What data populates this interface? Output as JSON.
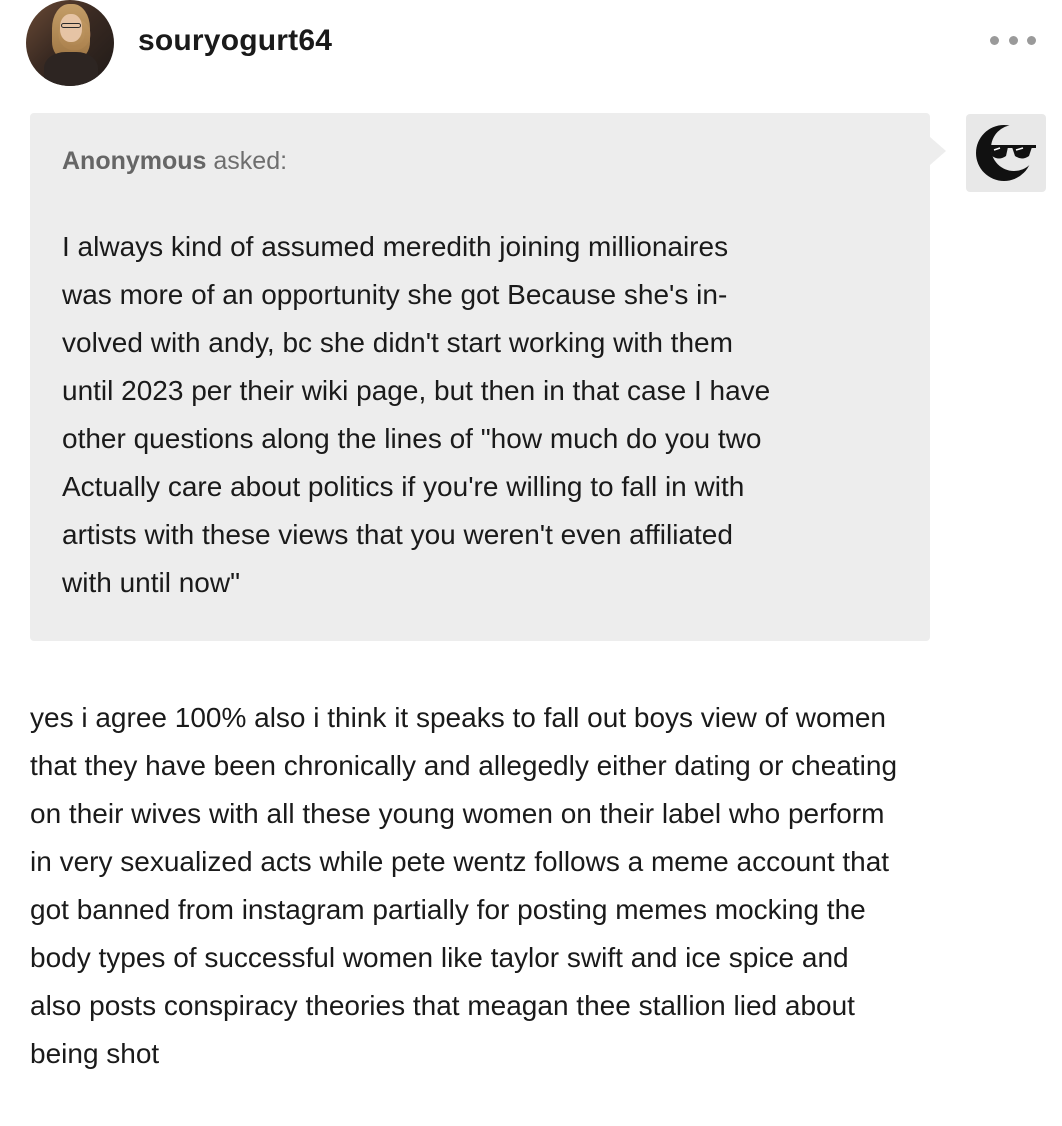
{
  "post": {
    "author": {
      "username": "souryogurt64",
      "avatar_icon": "user-avatar-photo"
    },
    "menu_icon": "more-options-ellipsis-icon",
    "ask": {
      "asker": "Anonymous",
      "asked_suffix": " asked:",
      "avatar_icon": "anonymous-sunglasses-moon-icon",
      "question_lines": [
        "I always kind of assumed meredith joining millionaires",
        "was more of an opportunity she got Because she's in-",
        "volved with andy, bc she didn't start working with them",
        "until 2023 per their wiki page, but then in that case I have",
        "other questions along the lines of \"how much do you two",
        "Actually care about politics if you're willing to fall in with",
        "artists with these views that you weren't even affiliated",
        "with until now\""
      ]
    },
    "answer_lines": [
      "yes i agree 100% also i think it speaks to fall out boys view of women",
      "that they have been chronically and allegedly either dating or cheating",
      "on their wives with all these young women on their label who perform",
      "in very sexualized acts while pete wentz follows a meme account that",
      "got banned from instagram partially for posting memes mocking the",
      "body types of successful women like taylor swift and ice spice and",
      "also posts conspiracy theories that meagan thee stallion lied about",
      "being shot"
    ]
  }
}
